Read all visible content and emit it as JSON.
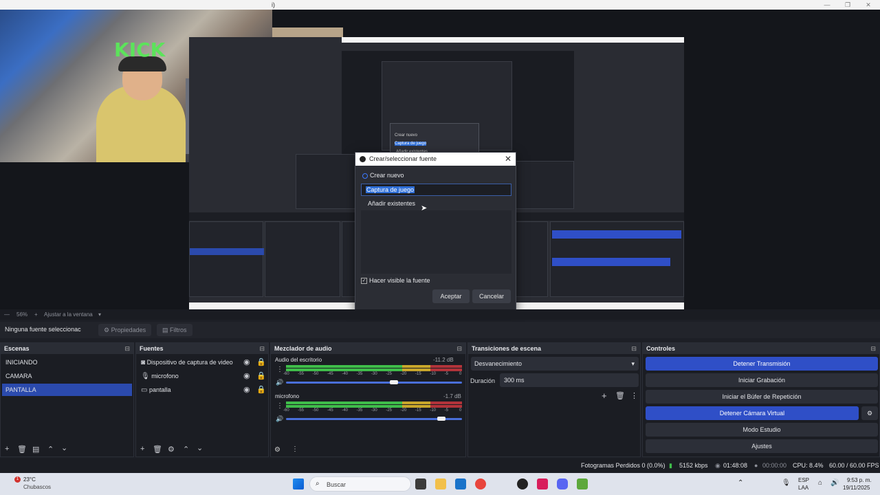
{
  "window": {
    "title_fragment": "i)",
    "controls": [
      "—",
      "❐",
      "✕"
    ]
  },
  "dialog": {
    "title": "Crear/seleccionar fuente",
    "option_new": "Crear nuevo",
    "new_name_value": "Captura de juego",
    "option_existing": "Añadir existentes",
    "visible_checkbox_label": "Hacer visible la fuente",
    "accept_label": "Aceptar",
    "cancel_label": "Cancelar"
  },
  "nested_preview": {
    "texts": [
      "Crear nuevo",
      "Captura de juego",
      "Añadir existentes"
    ],
    "webcam_sign": "KICK"
  },
  "zoombar": {
    "zoom": "56%",
    "fit_label": "Ajustar a la ventana"
  },
  "contextbar": {
    "no_source": "Ninguna fuente seleccionac",
    "properties": "Propiedades",
    "filters": "Filtros"
  },
  "scenes": {
    "title": "Escenas",
    "items": [
      {
        "label": "INICIANDO"
      },
      {
        "label": "CAMARA"
      },
      {
        "label": "PANTALLA",
        "selected": true
      }
    ]
  },
  "sources": {
    "title": "Fuentes",
    "items": [
      {
        "label": "Dispositivo de captura de video",
        "icon": "camera-icon"
      },
      {
        "label": "microfono",
        "icon": "microphone-icon"
      },
      {
        "label": "pantalla",
        "icon": "monitor-icon"
      }
    ]
  },
  "mixer": {
    "title": "Mezclador de audio",
    "ticks": [
      "-60",
      "-55",
      "-50",
      "-45",
      "-40",
      "-35",
      "-30",
      "-25",
      "-20",
      "-15",
      "-10",
      "-5",
      "0"
    ],
    "channels": [
      {
        "name": "Audio del escritorio",
        "db": "-11.2 dB",
        "level": 0.72,
        "volume": 0.62
      },
      {
        "name": "microfono",
        "db": "-1.7 dB",
        "level": 0.8,
        "volume": 0.9
      }
    ]
  },
  "transitions": {
    "title": "Transiciones de escena",
    "selected": "Desvanecimiento",
    "duration_label": "Duración",
    "duration_value": "300 ms"
  },
  "controls": {
    "title": "Controles",
    "buttons": [
      {
        "label": "Detener Transmisión",
        "active": true
      },
      {
        "label": "Iniciar Grabación",
        "active": false
      },
      {
        "label": "Iniciar el Búfer de Repetición",
        "active": false
      },
      {
        "label": "Detener Cámara Virtual",
        "active": true
      },
      {
        "label": "Modo Estudio",
        "active": false
      },
      {
        "label": "Ajustes",
        "active": false
      }
    ]
  },
  "status": {
    "dropped": "Fotogramas Perdidos 0 (0.0%)",
    "bitrate": "5152 kbps",
    "stream_time": "01:48:08",
    "rec_time": "00:00:00",
    "cpu": "CPU: 8.4%",
    "fps": "60.00 / 60.00 FPS"
  },
  "taskbar": {
    "weather_temp": "23°C",
    "weather_desc": "Chubascos",
    "search_placeholder": "Buscar",
    "lang": "ESP",
    "lang_sub": "LAA",
    "time": "9:53 p. m.",
    "date": "19/11/2025"
  },
  "colors": {
    "accent": "#2f4fc7",
    "selection": "#2b4aad",
    "bg": "#1d1f26"
  }
}
